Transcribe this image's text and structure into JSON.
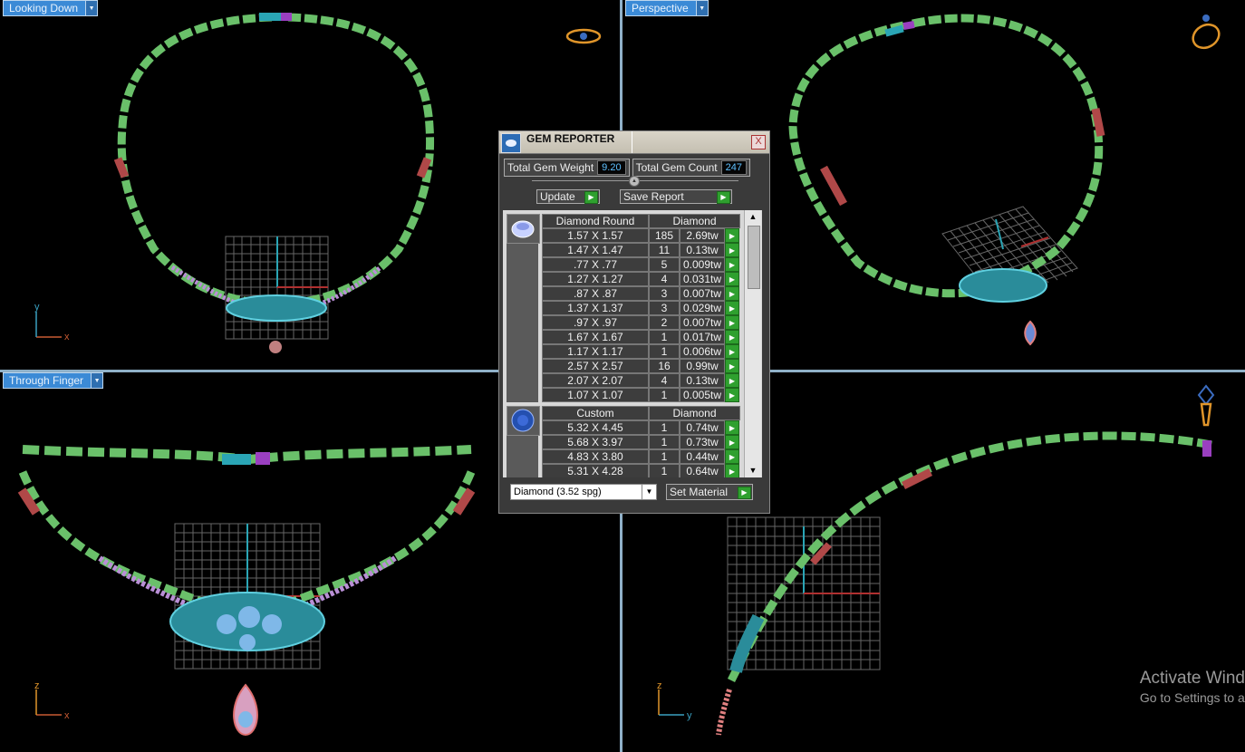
{
  "viewports": {
    "top_left": {
      "label": "Looking Down",
      "axis": [
        "y",
        "x"
      ]
    },
    "top_right": {
      "label": "Perspective"
    },
    "bottom_left": {
      "label": "Through Finger",
      "axis": [
        "z",
        "x"
      ]
    },
    "bottom_right": {
      "axis": [
        "z",
        "y"
      ]
    }
  },
  "watermark": {
    "line1": "Activate Wind",
    "line2": "Go to Settings to a"
  },
  "dialog": {
    "title": "GEM REPORTER",
    "close_label": "X",
    "total_weight_label": "Total Gem Weight",
    "total_weight_value": "9.20",
    "total_count_label": "Total Gem Count",
    "total_count_value": "247",
    "update_label": "Update",
    "save_report_label": "Save Report",
    "groups": [
      {
        "shape": "Diamond Round",
        "material": "Diamond",
        "icon": "round-gem-icon",
        "rows": [
          [
            "1.57 X 1.57",
            "185",
            "2.69tw"
          ],
          [
            "1.47 X 1.47",
            "11",
            "0.13tw"
          ],
          [
            ".77 X .77",
            "5",
            "0.009tw"
          ],
          [
            "1.27 X 1.27",
            "4",
            "0.031tw"
          ],
          [
            ".87 X .87",
            "3",
            "0.007tw"
          ],
          [
            "1.37 X 1.37",
            "3",
            "0.029tw"
          ],
          [
            ".97 X .97",
            "2",
            "0.007tw"
          ],
          [
            "1.67 X 1.67",
            "1",
            "0.017tw"
          ],
          [
            "1.17 X 1.17",
            "1",
            "0.006tw"
          ],
          [
            "2.57 X 2.57",
            "16",
            "0.99tw"
          ],
          [
            "2.07 X 2.07",
            "4",
            "0.13tw"
          ],
          [
            "1.07 X 1.07",
            "1",
            "0.005tw"
          ]
        ]
      },
      {
        "shape": "Custom",
        "material": "Diamond",
        "icon": "custom-gem-icon",
        "rows": [
          [
            "5.32 X 4.45",
            "1",
            "0.74tw"
          ],
          [
            "5.68 X 3.97",
            "1",
            "0.73tw"
          ],
          [
            "4.83 X 3.80",
            "1",
            "0.44tw"
          ],
          [
            "5.31 X 4.28",
            "1",
            "0.64tw"
          ]
        ]
      }
    ],
    "material_select": "Diamond    (3.52 spg)",
    "set_material_label": "Set Material"
  },
  "colors": {
    "viewport_label_bg": "#3b8ad6",
    "link_green": "#6ac06a",
    "link_red": "#b04848",
    "gem_teal": "#3aa0b0",
    "gem_lavender": "#b98fd6"
  }
}
